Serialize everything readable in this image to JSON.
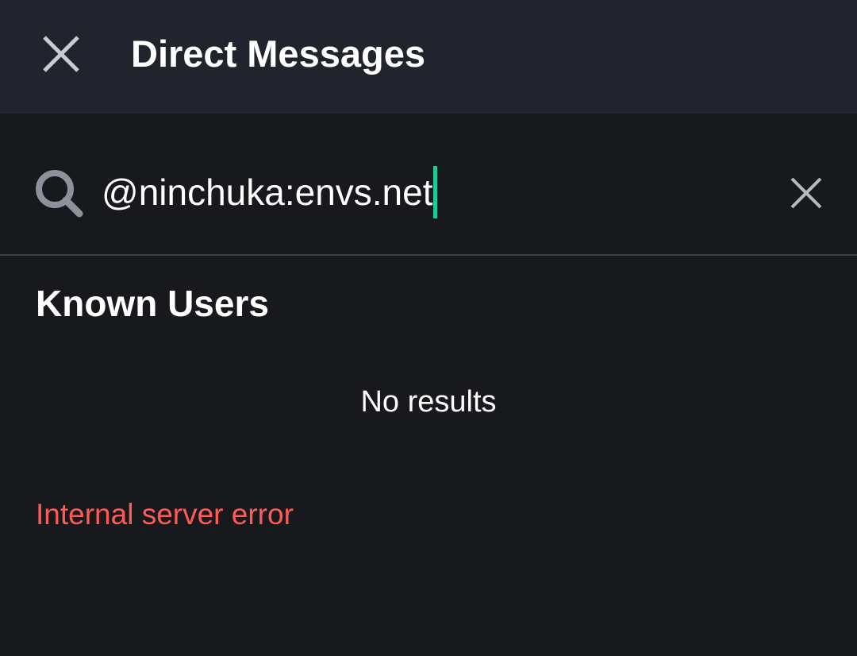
{
  "header": {
    "title": "Direct Messages",
    "close_icon": "close-icon"
  },
  "search": {
    "value": "@ninchuka:envs.net",
    "search_icon": "search-icon",
    "clear_icon": "clear-icon",
    "caret_color": "#1ec99a"
  },
  "results": {
    "section_heading": "Known Users",
    "empty_text": "No results"
  },
  "error": {
    "message": "Internal server error",
    "color": "#ff5b55"
  },
  "colors": {
    "toolbar_bg": "#21242c",
    "page_bg": "#18191d",
    "divider": "#3b3e45"
  }
}
